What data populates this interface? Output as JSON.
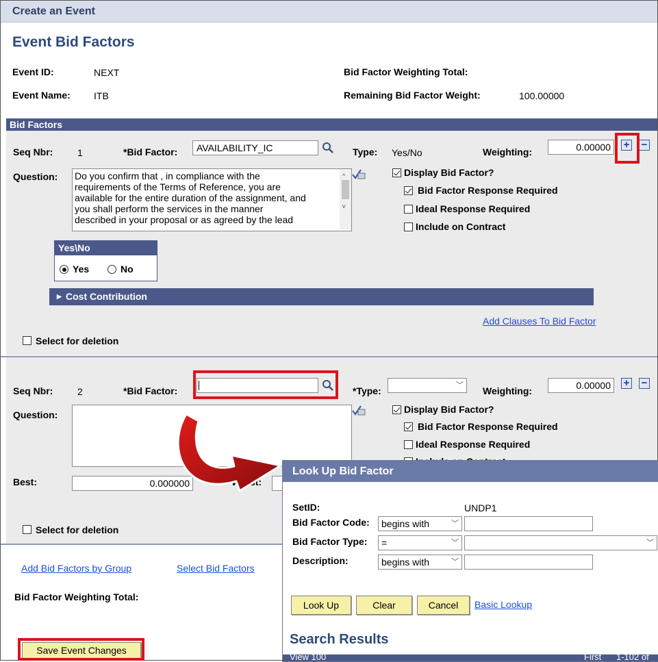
{
  "header": {
    "breadcrumb": "Create an Event",
    "title": "Event Bid Factors"
  },
  "event": {
    "id_label": "Event ID:",
    "id_value": "NEXT",
    "name_label": "Event Name:",
    "name_value": "ITB",
    "weighting_total_label": "Bid Factor Weighting Total:",
    "remaining_label": "Remaining Bid Factor Weight:",
    "remaining_value": "100.00000"
  },
  "bid_factors_section": {
    "title": "Bid Factors"
  },
  "factor1": {
    "seq_label": "Seq Nbr:",
    "seq": "1",
    "bid_factor_label": "*Bid Factor:",
    "bid_factor_value": "AVAILABILITY_IC",
    "type_label": "Type:",
    "type_value": "Yes/No",
    "weighting_label": "Weighting:",
    "weighting_value": "0.00000",
    "question_label": "Question:",
    "question_lines": [
      "Do you confirm that , in compliance with the",
      "requirements of the Terms of Reference, you are",
      "available for the entire duration of the assignment, and",
      "you shall perform the services in the manner",
      "described in your proposal or as agreed by the lead"
    ],
    "display_label": "Display Bid Factor?",
    "response_required_label": "Bid Factor Response Required",
    "ideal_response_label": "Ideal Response Required",
    "include_contract_label": "Include on Contract",
    "yesno_header": "Yes\\No",
    "yes_label": "Yes",
    "no_label": "No",
    "cost_contribution_label": "Cost Contribution",
    "add_clauses_link": "Add Clauses To Bid Factor",
    "select_deletion_label": "Select for deletion"
  },
  "factor2": {
    "seq_label": "Seq Nbr:",
    "seq": "2",
    "bid_factor_label": "*Bid Factor:",
    "bid_factor_value": "",
    "type_label": "*Type:",
    "type_value": "",
    "weighting_label": "Weighting:",
    "weighting_value": "0.00000",
    "question_label": "Question:",
    "display_label": "Display Bid Factor?",
    "response_required_label": "Bid Factor Response Required",
    "ideal_response_label": "Ideal Response Required",
    "include_contract_label": "Include on Contract",
    "best_label": "Best:",
    "best_value": "0.000000",
    "worst_label": "Worst:",
    "select_deletion_label": "Select for deletion"
  },
  "footer": {
    "add_by_group_link": "Add Bid Factors by Group",
    "select_bid_factors_link": "Select Bid Factors",
    "weighting_total_label": "Bid Factor Weighting Total:",
    "save_button": "Save Event Changes"
  },
  "lookup": {
    "title": "Look Up Bid Factor",
    "setid_label": "SetID:",
    "setid_value": "UNDP1",
    "code_label": "Bid Factor Code:",
    "code_operator": "begins with",
    "type_label": "Bid Factor Type:",
    "type_operator": "=",
    "description_label": "Description:",
    "description_operator": "begins with",
    "lookup_button": "Look Up",
    "clear_button": "Clear",
    "cancel_button": "Cancel",
    "basic_lookup_link": "Basic Lookup",
    "search_results_title": "Search Results",
    "view_label": "View 100",
    "first_label": "First",
    "range_label": "1-102 of"
  },
  "colors": {
    "annotation_red": "#d9151c",
    "bar_blue": "#4a5989",
    "button_yellow": "#f6f0a8",
    "link_blue": "#1a4fd6"
  }
}
